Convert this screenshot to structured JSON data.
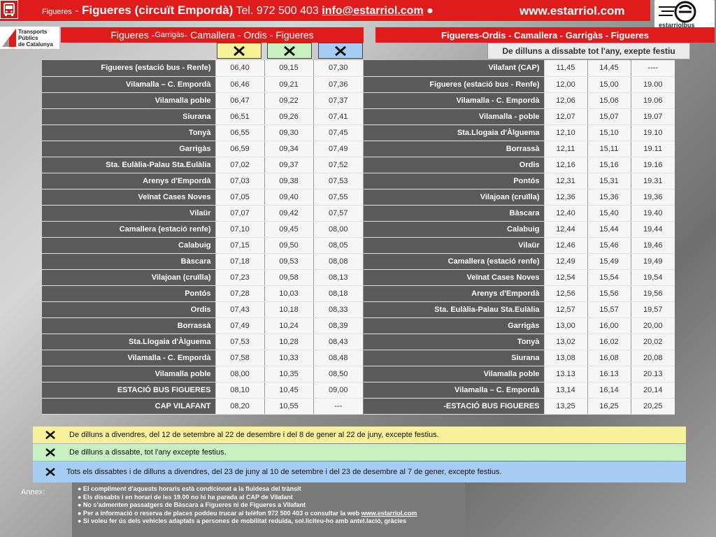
{
  "header": {
    "prefix": "Figueres",
    "dash": " - ",
    "title": "Figueres (circuït Empordà)",
    "tel": " Tel. 972 500 403   ",
    "email": "info@estarriol.com",
    "bullet": " ●",
    "website": "www.estarriol.com",
    "logo_text": "estarriolbus",
    "left_logo_lines": [
      "Transports",
      "Públics",
      "de Catalunya"
    ]
  },
  "route_left": {
    "a": "Figueres - ",
    "b": "Garrigàs",
    "c": " - Camallera - Ordis - Figueres"
  },
  "route_right": "Figueres-Ordis  - Camallera -  Garrigàs - Figueres",
  "days_note": "De dilluns a dissabte tot l'any, exepte festiu",
  "colors": {
    "red": "#e01b1b",
    "yellow": "#f7f29a",
    "green": "#c8f0c0",
    "blue": "#a6cdf3"
  },
  "icons": [
    "bus-icon",
    "cross-symbol-icon"
  ],
  "outbound": [
    [
      "Figueres (estació bus - Renfe)",
      "06,40",
      "09,15",
      "07,30"
    ],
    [
      "Vilamalla – C. Empordà",
      "06,46",
      "09,21",
      "07,36"
    ],
    [
      "Vilamalla poble",
      "06,47",
      "09,22",
      "07,37"
    ],
    [
      "Siurana",
      "06,51",
      "09,26",
      "07,41"
    ],
    [
      "Tonyà",
      "06,55",
      "09,30",
      "07,45"
    ],
    [
      "Garrigàs",
      "06,59",
      "09,34",
      "07,49"
    ],
    [
      "Sta. Eulàlia-Palau Sta.Eulàlia",
      "07,02",
      "09,37",
      "07,52"
    ],
    [
      "Arenys d'Empordà",
      "07,03",
      "09,38",
      "07,53"
    ],
    [
      "Veïnat Cases Noves",
      "07,05",
      "09,40",
      "07,55"
    ],
    [
      "Vilaür",
      "07,07",
      "09,42",
      "07,57"
    ],
    [
      "Camallera (estació renfe)",
      "07,10",
      "09,45",
      "08,00"
    ],
    [
      "Calabuig",
      "07,15",
      "09,50",
      "08,05"
    ],
    [
      "Bàscara",
      "07,18",
      "09,53",
      "08,08"
    ],
    [
      "Vilajoan (cruïlla)",
      "07,23",
      "09,58",
      "08,13"
    ],
    [
      "Pontós",
      "07,28",
      "10,03",
      "08,18"
    ],
    [
      "Ordis",
      "07,43",
      "10,18",
      "08,33"
    ],
    [
      "Borrassà",
      "07,49",
      "10,24",
      "08,39"
    ],
    [
      "Sta.Llogaia d'Àlguema",
      "07,53",
      "10,28",
      "08,43"
    ],
    [
      "Vilamalla - C. Empordà",
      "07,58",
      "10,33",
      "08,48"
    ],
    [
      "Vilamalla poble",
      "08,00",
      "10,35",
      "08,50"
    ],
    [
      "ESTACIÓ BUS FIGUERES",
      "08,10",
      "10,45",
      "09,00"
    ],
    [
      "CAP VILAFANT",
      "08,20",
      "10,55",
      "---"
    ]
  ],
  "inbound": [
    [
      "Vilafant (CAP)",
      "11,45",
      "14,45",
      "----"
    ],
    [
      "Figueres (estació bus - Renfe)",
      "12,00",
      "15,00",
      "19.00"
    ],
    [
      "Vilamalla - C. Empordà",
      "12,06",
      "15,06",
      "19.06"
    ],
    [
      "Vilamalla - poble",
      "12,07",
      "15,07",
      "19.07"
    ],
    [
      "Sta.Llogaia d'Àlguema",
      "12,10",
      "15,10",
      "19.10"
    ],
    [
      "Borrassà",
      "12,11",
      "15,11",
      "19.11"
    ],
    [
      "Ordis",
      "12,16",
      "15,16",
      "19.16"
    ],
    [
      "Pontós",
      "12,31",
      "15,31",
      "19.31"
    ],
    [
      "Vilajoan (cruïlla)",
      "12,36",
      "15,36",
      "19,36"
    ],
    [
      "Bàscara",
      "12,40",
      "15,40",
      "19.40"
    ],
    [
      "Calabuig",
      "12,44",
      "15,44",
      "19,44"
    ],
    [
      "Vilaür",
      "12,46",
      "15,46",
      "19,46"
    ],
    [
      "Camallera (estació renfe)",
      "12,49",
      "15,49",
      "19,49"
    ],
    [
      "Veïnat Cases Noves",
      "12,54",
      "15,54",
      "19,54"
    ],
    [
      "Arenys d'Empordà",
      "12,56",
      "15,56",
      "19,56"
    ],
    [
      "Sta. Eulàlia-Palau Sta.Eulàlia",
      "12,57",
      "15,57",
      "19,57"
    ],
    [
      "Garrigàs",
      "13,00",
      "16,00",
      "20,00"
    ],
    [
      "Tonyà",
      "13,02",
      "16,02",
      "20,02"
    ],
    [
      "Siurana",
      "13,08",
      "16,08",
      "20,08"
    ],
    [
      "Vilamalla poble",
      "13.13",
      "16.13",
      "20.13"
    ],
    [
      "Vilamalla – C. Empordà",
      "13,14",
      "16,14",
      "20,14"
    ],
    [
      "-ESTACIÓ BUS FIGUERES",
      "13,25",
      "16,25",
      "20,25"
    ]
  ],
  "legend": [
    "De dilluns a divendres, del 12 de setembre al 22 de desembre i del 8 de gener al 22 de juny, excepte festius.",
    "De dilluns a dissabte, tot l'any excepte festius.",
    "Tots els dissabtes i de dilluns a divendres, del 23 de juny al 10 de setembre i del 23 de desembre al 7 de gener, excepte festius."
  ],
  "annex": {
    "label": "Annex:",
    "items": [
      "● El compliment d'aquests horaris està condicionat a la fluïdesa del trànsit",
      "● Els dissabts i en horari de les 19.00 no hi ha parada al CAP de Vilafant",
      "● No s'admenten passatgers de Bàscara a Figueres ni de Figueres a Vilafant"
    ],
    "info_text": "● Per a informació o reserva de places poddeu trucar al telèfon 972 500 403 o consultar la web ",
    "info_link": "www.estarriol.com",
    "last": "● Si voleu fer ús dels vehicles adaptats a persones de mobilitat reduïda, sol.liciteu-ho amb antel.lació, gràcies"
  }
}
